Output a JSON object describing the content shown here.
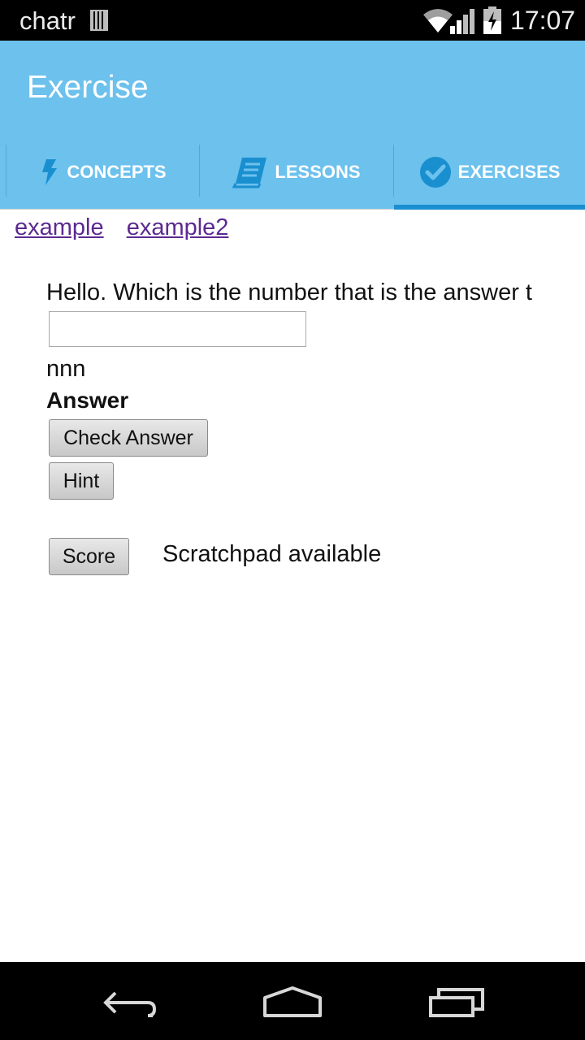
{
  "status_bar": {
    "carrier": "chatr",
    "time": "17:07",
    "icons": [
      "sim-card-icon",
      "wifi-icon",
      "cell-signal-icon",
      "battery-charging-icon"
    ]
  },
  "action_bar": {
    "title": "Exercise"
  },
  "tabs": [
    {
      "label": "CONCEPTS",
      "icon": "lightning-icon",
      "selected": false
    },
    {
      "label": "LESSONS",
      "icon": "book-icon",
      "selected": false
    },
    {
      "label": "EXERCISES",
      "icon": "checkmark-circle-icon",
      "selected": true
    }
  ],
  "links": [
    "example",
    "example2"
  ],
  "exercise": {
    "question": "Hello. Which is the number that is the answer t",
    "input_value": "",
    "nnn_text": "nnn",
    "answer_label": "Answer",
    "check_button": "Check Answer",
    "hint_button": "Hint",
    "score_button": "Score",
    "scratchpad_text": "Scratchpad available"
  },
  "nav_bar": {
    "icons": [
      "back-icon",
      "home-icon",
      "recent-apps-icon"
    ]
  },
  "colors": {
    "action_bar": "#6cc1ed",
    "tab_indicator": "#1a8fd0",
    "link": "#5b2a91"
  }
}
